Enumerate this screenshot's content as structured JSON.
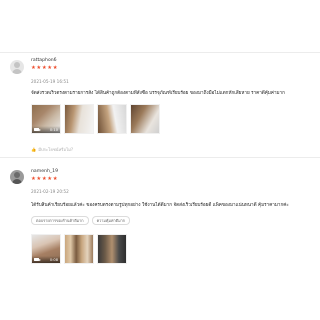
{
  "reviews": [
    {
      "username": "rattaphon6",
      "stars": "★★★★★",
      "date": "2021-05-19 16:51",
      "comment": "จัดส่งรวดเร็วตรงตามรายการสั่ง ได้สินค้าถูกต้องตามที่สั่งซื้อ บรรจุภัณฑ์เรียบร้อย ของมาถึงมือไม่แตกหักเสียหาย ราคาดีคุ้มค่ามาก",
      "media": [
        {
          "type": "video",
          "duration": "0:10"
        },
        {
          "type": "image"
        },
        {
          "type": "image"
        },
        {
          "type": "image"
        }
      ],
      "helpful": "มีประโยชน์หรือไม่?"
    },
    {
      "username": "namenh_19",
      "stars": "★★★★★",
      "date": "2021-02-19 20:52",
      "comment": "ได้รับสินค้าเรียบร้อยแล้วค่ะ ของครบตรงตามรูปทุกอย่าง ใช้งานได้ดีมาก จัดส่งเร็วเรียบร้อยดี แพ็คของมาแน่นหนาดี คุ้มราคามากค่ะ",
      "tags": [
        "ตอบรายการของร้านค้าดีมาก",
        "ความคุ้มค่าดีมาก"
      ],
      "media": [
        {
          "type": "video",
          "duration": "0:08"
        },
        {
          "type": "image"
        },
        {
          "type": "image"
        }
      ]
    }
  ],
  "colors": {
    "star": "#ee4d2d",
    "divider": "#ececec",
    "muted": "#8a8a8a"
  },
  "icons": {
    "avatar1": "default-avatar-icon",
    "avatar2": "user-photo-avatar",
    "video": "video-camera-icon",
    "helpful": "thumbs-up-icon"
  }
}
